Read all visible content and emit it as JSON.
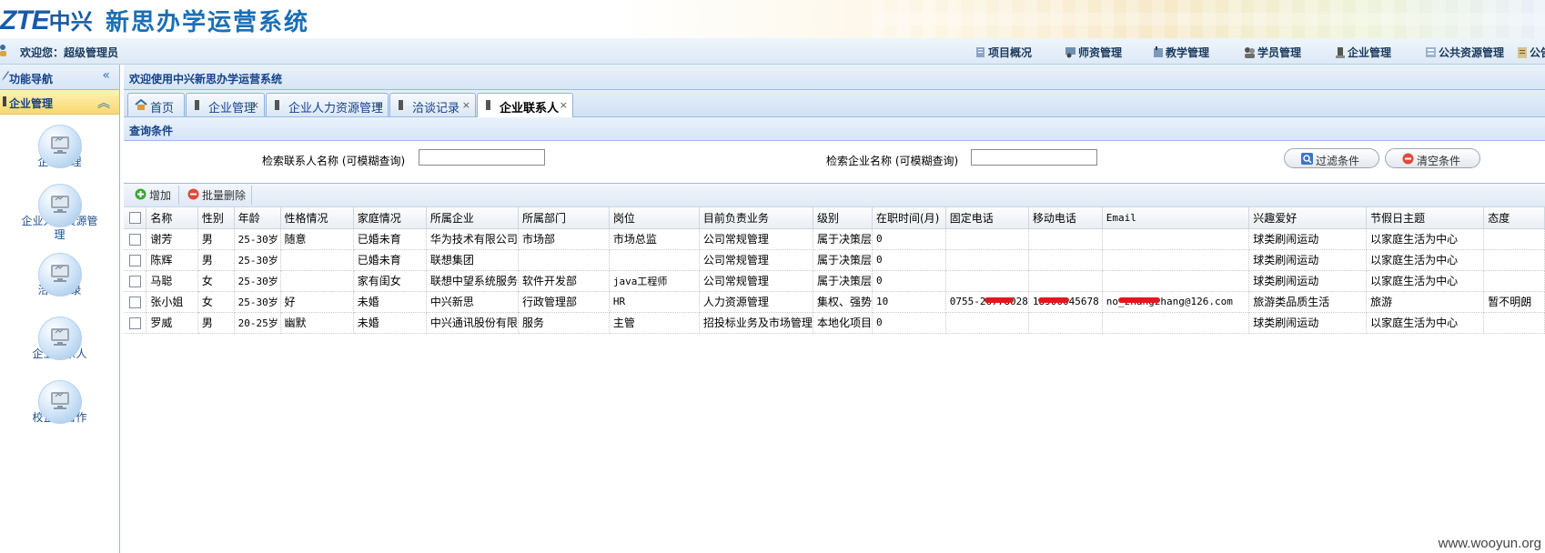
{
  "header": {
    "logo_latin": "ZTE",
    "logo_cn": "中兴",
    "system_title": "新思办学运营系统"
  },
  "navbar": {
    "welcome": "欢迎您：超级管理员",
    "items": [
      "项目概况",
      "师资管理",
      "教学管理",
      "学员管理",
      "企业管理",
      "公共资源管理",
      "公告"
    ]
  },
  "left_panel": {
    "title": "功能导航",
    "section": "企业管理",
    "items": [
      "企业管理",
      "企业人力资源管理",
      "洽谈记录",
      "企业联系人",
      "校企业合作"
    ]
  },
  "main": {
    "title": "欢迎使用中兴新思办学运营系统",
    "tabs": [
      "首页",
      "企业管理",
      "企业人力资源管理",
      "洽谈记录",
      "企业联系人"
    ],
    "query_title": "查询条件",
    "query": {
      "contact_label": "检索联系人名称 (可模糊查询)",
      "company_label": "检索企业名称 (可模糊查询)",
      "filter_btn": "过滤条件",
      "clear_btn": "清空条件"
    },
    "toolbar": {
      "add": "增加",
      "batch_delete": "批量删除"
    }
  },
  "grid": {
    "columns": [
      "名称",
      "性别",
      "年龄",
      "性格情况",
      "家庭情况",
      "所属企业",
      "所属部门",
      "岗位",
      "目前负责业务",
      "级别",
      "在职时间(月)",
      "固定电话",
      "移动电话",
      "Email",
      "兴趣爱好",
      "节假日主题",
      "态度"
    ],
    "rows": [
      [
        "谢芳",
        "男",
        "25-30岁",
        "随意",
        "已婚未育",
        "华为技术有限公司",
        "市场部",
        "市场总监",
        "公司常规管理",
        "属于决策层",
        "0",
        "",
        "",
        "",
        "球类刷闹运动",
        "以家庭生活为中心",
        ""
      ],
      [
        "陈辉",
        "男",
        "25-30岁",
        "",
        "已婚未育",
        "联想集团",
        "",
        "",
        "公司常规管理",
        "属于决策层",
        "0",
        "",
        "",
        "",
        "球类刷闹运动",
        "以家庭生活为中心",
        ""
      ],
      [
        "马聪",
        "女",
        "25-30岁",
        "",
        "家有闺女",
        "联想中望系统服务",
        "软件开发部",
        "java工程师",
        "公司常规管理",
        "属于决策层",
        "0",
        "",
        "",
        "",
        "球类刷闹运动",
        "以家庭生活为中心",
        ""
      ],
      [
        "张小姐",
        "女",
        "25-30岁",
        "好",
        "未婚",
        "中兴新思",
        "行政管理部",
        "HR",
        "人力资源管理",
        "集权、强势",
        "10",
        "0755-26778028",
        "18900045678",
        "no_zhangzhang@126.com",
        "旅游类品质生活",
        "旅游",
        "暂不明朗"
      ],
      [
        "罗威",
        "男",
        "20-25岁",
        "幽默",
        "未婚",
        "中兴通讯股份有限",
        "服务",
        "主管",
        "招投标业务及市场管理",
        "本地化项目",
        "0",
        "",
        "",
        "",
        "球类刷闹运动",
        "以家庭生活为中心",
        ""
      ]
    ]
  },
  "watermark": "www.wooyun.org"
}
